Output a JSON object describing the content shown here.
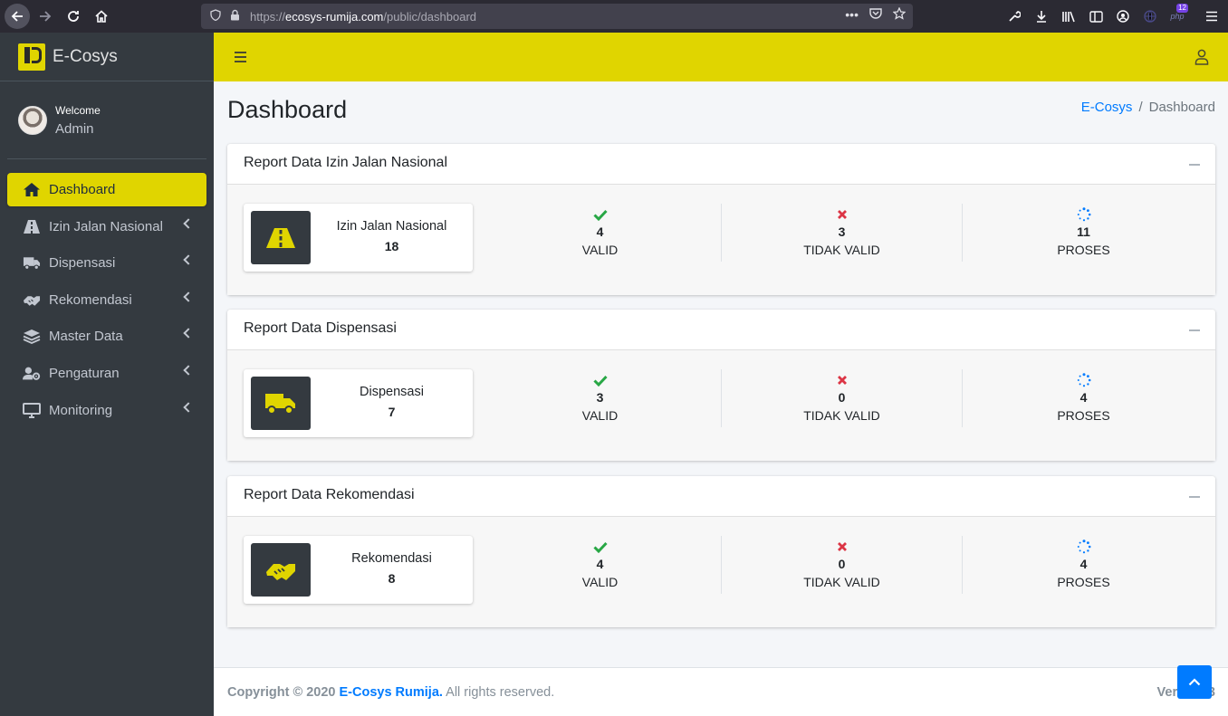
{
  "browser": {
    "url_prefix": "https://",
    "url_domain": "ecosys-rumija.com",
    "url_path": "/public/dashboard",
    "ext_badge": "12"
  },
  "brand": {
    "name": "E-Cosys"
  },
  "user": {
    "welcome": "Welcome",
    "name": "Admin"
  },
  "sidebar": {
    "items": [
      {
        "label": "Dashboard",
        "icon": "home-icon"
      },
      {
        "label": "Izin Jalan Nasional",
        "icon": "road-icon"
      },
      {
        "label": "Dispensasi",
        "icon": "truck-icon"
      },
      {
        "label": "Rekomendasi",
        "icon": "handshake-icon"
      },
      {
        "label": "Master Data",
        "icon": "layers-icon"
      },
      {
        "label": "Pengaturan",
        "icon": "users-cog-icon"
      },
      {
        "label": "Monitoring",
        "icon": "desktop-icon"
      }
    ]
  },
  "page": {
    "title": "Dashboard",
    "breadcrumb": {
      "root": "E-Cosys",
      "sep": "/",
      "current": "Dashboard"
    }
  },
  "cards": [
    {
      "title": "Report Data Izin Jalan Nasional",
      "box_label": "Izin Jalan Nasional",
      "box_value": "18",
      "valid": "4",
      "valid_label": "VALID",
      "invalid": "3",
      "invalid_label": "TIDAK VALID",
      "proses": "11",
      "proses_label": "PROSES"
    },
    {
      "title": "Report Data Dispensasi",
      "box_label": "Dispensasi",
      "box_value": "7",
      "valid": "3",
      "valid_label": "VALID",
      "invalid": "0",
      "invalid_label": "TIDAK VALID",
      "proses": "4",
      "proses_label": "PROSES"
    },
    {
      "title": "Report Data Rekomendasi",
      "box_label": "Rekomendasi",
      "box_value": "8",
      "valid": "4",
      "valid_label": "VALID",
      "invalid": "0",
      "invalid_label": "TIDAK VALID",
      "proses": "4",
      "proses_label": "PROSES"
    }
  ],
  "footer": {
    "copyright": "Copyright © 2020",
    "brand": "E-Cosys Rumija.",
    "rights": "All rights reserved.",
    "version": "Version 3"
  },
  "colors": {
    "accent": "#e0d500",
    "sidebar": "#343a40",
    "valid": "#28a745",
    "invalid": "#dc3545",
    "proses": "#007bff"
  }
}
